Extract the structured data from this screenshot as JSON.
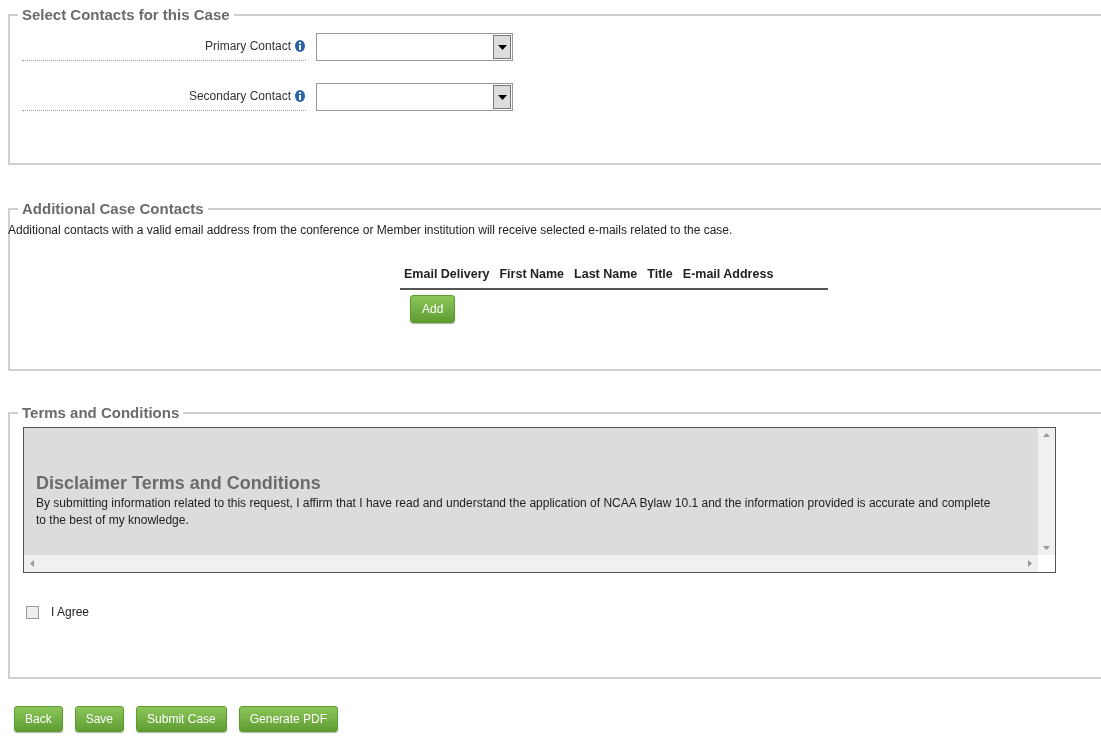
{
  "contacts": {
    "legend": "Select Contacts for this Case",
    "fields": [
      {
        "label": "Primary Contact"
      },
      {
        "label": "Secondary Contact"
      }
    ]
  },
  "additional": {
    "legend": "Additional Case Contacts",
    "note": "Additional contacts with a valid email address from the conference or Member institution will receive selected e-mails related to the case.",
    "columns": [
      "Email Delivery",
      "First Name",
      "Last Name",
      "Title",
      "E-mail Address"
    ],
    "add_button": "Add"
  },
  "terms": {
    "legend": "Terms and Conditions",
    "heading": "Disclaimer Terms and Conditions",
    "body": "By submitting information related to this request, I affirm that I have read and understand the application of NCAA Bylaw 10.1 and the information provided is accurate and complete to the best of my knowledge.",
    "agree": {
      "label": "I Agree",
      "checked": false
    }
  },
  "buttons": [
    "Back",
    "Save",
    "Submit Case",
    "Generate PDF"
  ]
}
